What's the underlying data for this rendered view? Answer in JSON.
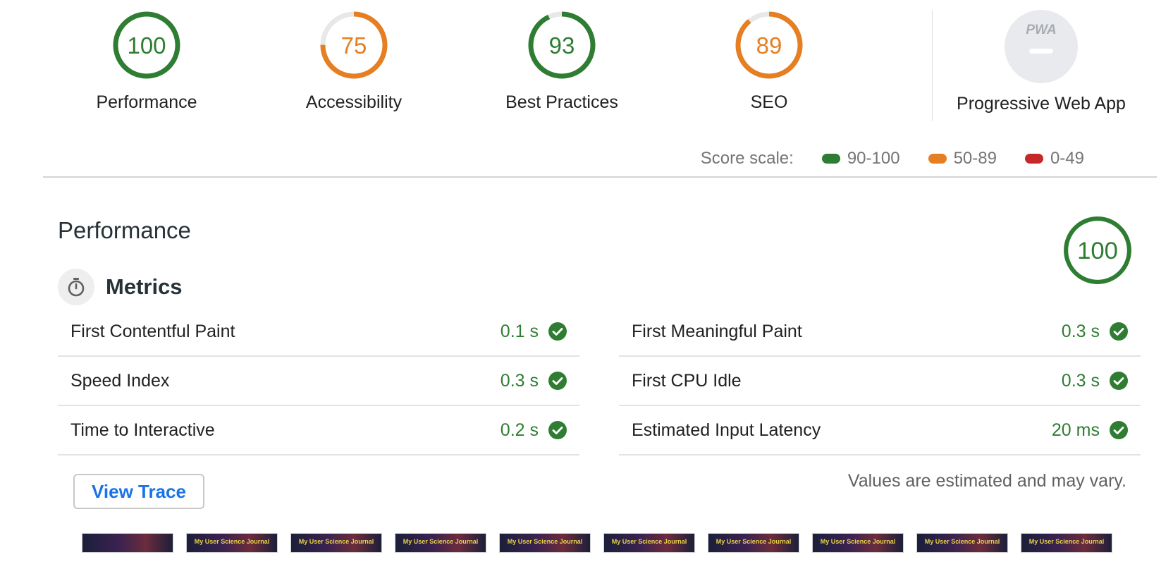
{
  "categories": [
    {
      "label": "Performance",
      "score": 100,
      "color": "#2e7d32"
    },
    {
      "label": "Accessibility",
      "score": 75,
      "color": "#e67e22"
    },
    {
      "label": "Best Practices",
      "score": 93,
      "color": "#2e7d32"
    },
    {
      "label": "SEO",
      "score": 89,
      "color": "#e67e22"
    }
  ],
  "pwa": {
    "badge": "PWA",
    "label": "Progressive Web App"
  },
  "scale": {
    "label": "Score scale:",
    "ranges": [
      {
        "label": "90-100",
        "color": "#2e7d32"
      },
      {
        "label": "50-89",
        "color": "#e67e22"
      },
      {
        "label": "0-49",
        "color": "#c62828"
      }
    ]
  },
  "performance": {
    "title": "Performance",
    "score": 100,
    "metrics_title": "Metrics",
    "metrics": [
      {
        "name": "First Contentful Paint",
        "value": "0.1 s"
      },
      {
        "name": "First Meaningful Paint",
        "value": "0.3 s"
      },
      {
        "name": "Speed Index",
        "value": "0.3 s"
      },
      {
        "name": "First CPU Idle",
        "value": "0.3 s"
      },
      {
        "name": "Time to Interactive",
        "value": "0.2 s"
      },
      {
        "name": "Estimated Input Latency",
        "value": "20 ms"
      }
    ],
    "view_trace_label": "View Trace",
    "note": "Values are estimated and may vary.",
    "filmstrip_caption": "My User Science Journal"
  }
}
